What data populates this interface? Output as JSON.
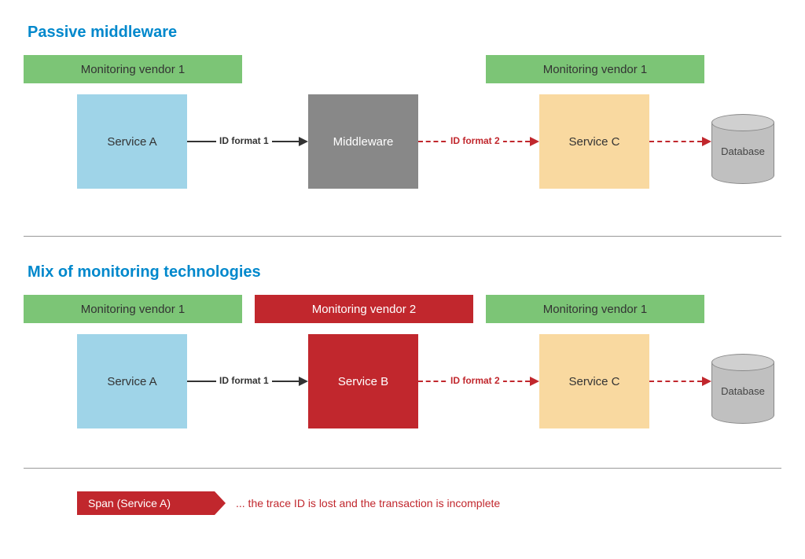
{
  "section1": {
    "title": "Passive middleware",
    "vendor1_left": "Monitoring vendor 1",
    "vendor1_right": "Monitoring vendor 1",
    "service_a": "Service A",
    "middleware": "Middleware",
    "service_c": "Service C",
    "database": "Database",
    "arrow1_label": "ID format 1",
    "arrow2_label": "ID format 2"
  },
  "section2": {
    "title": "Mix of monitoring technologies",
    "vendor1_left": "Monitoring vendor 1",
    "vendor2_mid": "Monitoring vendor 2",
    "vendor1_right": "Monitoring vendor 1",
    "service_a": "Service A",
    "service_b": "Service B",
    "service_c": "Service C",
    "database": "Database",
    "arrow1_label": "ID format 1",
    "arrow2_label": "ID format 2"
  },
  "span": {
    "label": "Span (Service A)",
    "description": "... the trace ID is lost and the transaction is incomplete"
  }
}
